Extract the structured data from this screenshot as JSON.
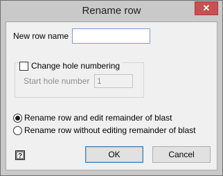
{
  "window": {
    "title": "Rename row",
    "close_glyph": "✕"
  },
  "form": {
    "new_row_name_label": "New row name",
    "new_row_name_value": "",
    "change_hole_numbering_label": "Change hole numbering",
    "change_hole_numbering_checked": false,
    "start_hole_number_label": "Start hole number",
    "start_hole_number_value": "1"
  },
  "options": [
    {
      "label": "Rename row and edit remainder of blast",
      "selected": true
    },
    {
      "label": "Rename row without editing remainder of blast",
      "selected": false
    }
  ],
  "buttons": {
    "ok": "OK",
    "cancel": "Cancel"
  },
  "icons": {
    "help": "help-question-icon",
    "close": "close-icon"
  },
  "colors": {
    "close_button": "#c75050",
    "titlebar": "#c9c9c9",
    "client_bg": "#f0f0f0"
  }
}
